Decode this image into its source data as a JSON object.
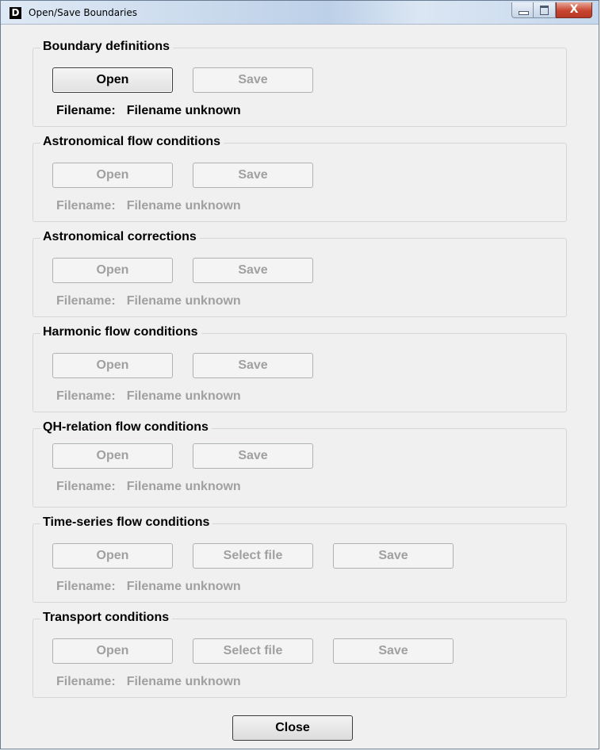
{
  "window": {
    "title": "Open/Save Boundaries",
    "icon_letter": "D",
    "close_glyph": "X"
  },
  "groups": [
    {
      "title": "Boundary definitions",
      "open": "Open",
      "save": "Save",
      "filename_label": "Filename:",
      "filename_value": "Filename unknown",
      "enabled": true
    },
    {
      "title": "Astronomical flow conditions",
      "open": "Open",
      "save": "Save",
      "filename_label": "Filename:",
      "filename_value": "Filename unknown",
      "enabled": false
    },
    {
      "title": "Astronomical corrections",
      "open": "Open",
      "save": "Save",
      "filename_label": "Filename:",
      "filename_value": "Filename unknown",
      "enabled": false
    },
    {
      "title": "Harmonic flow conditions",
      "open": "Open",
      "save": "Save",
      "filename_label": "Filename:",
      "filename_value": "Filename unknown",
      "enabled": false
    },
    {
      "title": "QH-relation flow conditions",
      "open": "Open",
      "save": "Save",
      "filename_label": "Filename:",
      "filename_value": "Filename unknown",
      "enabled": false
    },
    {
      "title": "Time-series flow conditions",
      "open": "Open",
      "select": "Select file",
      "save": "Save",
      "filename_label": "Filename:",
      "filename_value": "Filename unknown",
      "enabled": false
    },
    {
      "title": "Transport conditions",
      "open": "Open",
      "select": "Select file",
      "save": "Save",
      "filename_label": "Filename:",
      "filename_value": "Filename unknown",
      "enabled": false
    }
  ],
  "close_label": "Close"
}
